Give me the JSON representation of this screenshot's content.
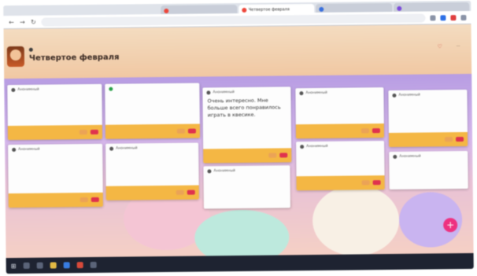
{
  "browser": {
    "tabs": [
      {
        "label": "",
        "active": false
      },
      {
        "label": "Четвертое февраля",
        "active": true
      },
      {
        "label": "",
        "active": false
      },
      {
        "label": "",
        "active": false
      }
    ],
    "url": "",
    "nav_back": "←",
    "nav_forward": "→",
    "nav_reload": "↻"
  },
  "header": {
    "breadcrumb": "",
    "title": "Четвертое февраля",
    "subtitle": "",
    "right_link_1": "",
    "right_link_2": ""
  },
  "cards": [
    {
      "id": "c1",
      "author": "Анонимный",
      "body": "",
      "actions": {
        "edit": "",
        "delete": ""
      }
    },
    {
      "id": "c2",
      "author": "",
      "body": "",
      "actions": {
        "edit": "",
        "delete": ""
      }
    },
    {
      "id": "c3",
      "author": "Анонимный",
      "body": "Очень интересно. Мне больше всего понравилось играть в квесике.",
      "footer_note": "",
      "actions": {
        "edit": "",
        "delete": ""
      }
    },
    {
      "id": "c4",
      "author": "Анонимный",
      "body": "",
      "actions": {
        "edit": "",
        "delete": ""
      }
    },
    {
      "id": "c5",
      "author": "Анонимный",
      "body": "",
      "actions": {
        "edit": "",
        "delete": ""
      }
    },
    {
      "id": "c6",
      "author": "Анонимный",
      "body": "",
      "actions": {
        "edit": "",
        "delete": ""
      }
    },
    {
      "id": "c7",
      "author": "Анонимный",
      "body": "",
      "actions": {
        "edit": "",
        "delete": ""
      }
    },
    {
      "id": "c8",
      "author": "Анонимный",
      "body": "",
      "actions": {
        "edit": "",
        "delete": ""
      }
    },
    {
      "id": "c9",
      "author": "Анонимный",
      "body": "",
      "actions": {
        "edit": "",
        "delete": ""
      }
    },
    {
      "id": "c10",
      "author": "Анонимный",
      "body": ""
    }
  ],
  "candy_words": [
    "",
    "",
    "",
    "",
    ""
  ],
  "fab_label": "+",
  "colors": {
    "card_footer": "#f1b74a",
    "delete_button": "#d9344f",
    "edit_button": "#e8a35a",
    "fab": "#e7337e",
    "header_bg": "#efc8a5"
  },
  "taskbar": {
    "start_icon": "windows-icon",
    "clock_time": "",
    "clock_date": ""
  }
}
